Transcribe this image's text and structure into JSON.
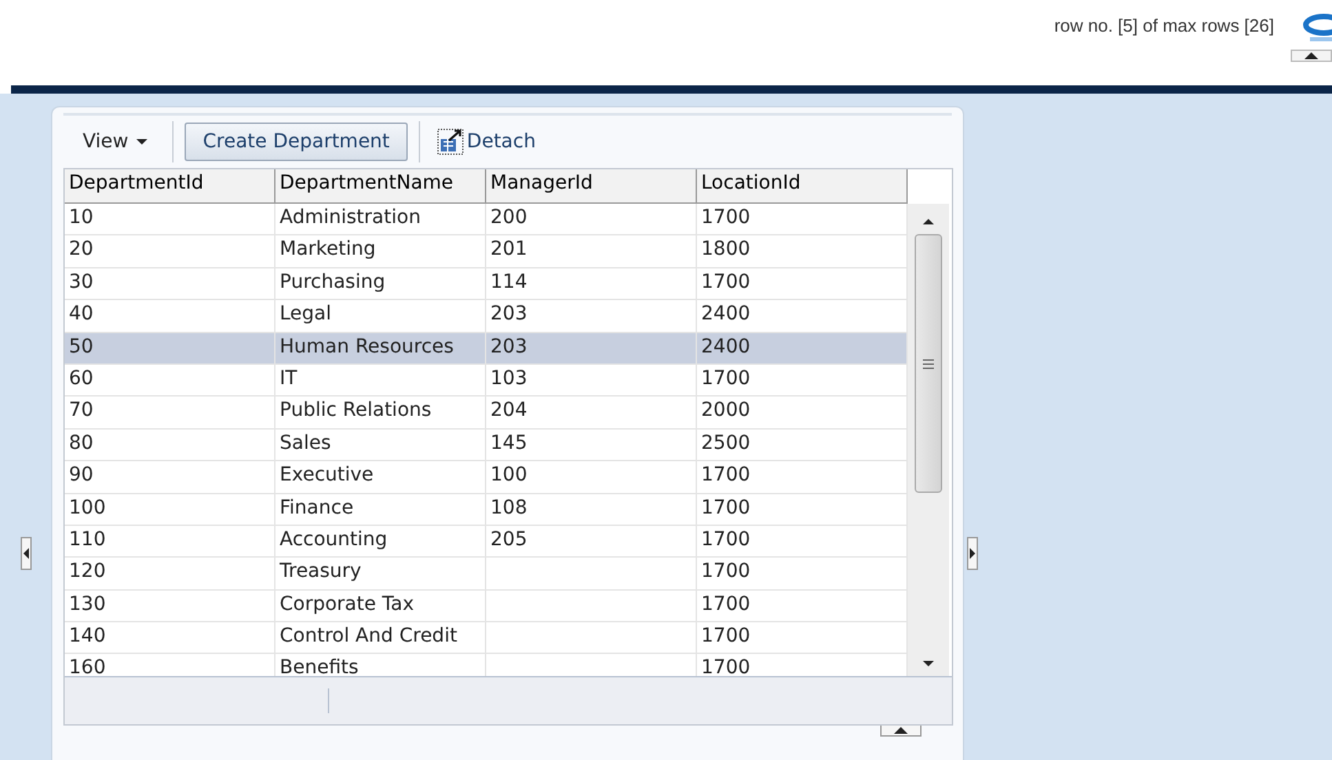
{
  "header": {
    "status": "row no. [5] of max rows [26]"
  },
  "toolbar": {
    "view_menu": "View",
    "create_button": "Create Department",
    "detach_button": "Detach"
  },
  "table": {
    "columns": [
      "DepartmentId",
      "DepartmentName",
      "ManagerId",
      "LocationId"
    ],
    "rows": [
      {
        "cells": [
          "10",
          "Administration",
          "200",
          "1700"
        ],
        "selected": false
      },
      {
        "cells": [
          "20",
          "Marketing",
          "201",
          "1800"
        ],
        "selected": false
      },
      {
        "cells": [
          "30",
          "Purchasing",
          "114",
          "1700"
        ],
        "selected": false
      },
      {
        "cells": [
          "40",
          "Legal",
          "203",
          "2400"
        ],
        "selected": false
      },
      {
        "cells": [
          "50",
          "Human Resources",
          "203",
          "2400"
        ],
        "selected": true
      },
      {
        "cells": [
          "60",
          "IT",
          "103",
          "1700"
        ],
        "selected": false
      },
      {
        "cells": [
          "70",
          "Public Relations",
          "204",
          "2000"
        ],
        "selected": false
      },
      {
        "cells": [
          "80",
          "Sales",
          "145",
          "2500"
        ],
        "selected": false
      },
      {
        "cells": [
          "90",
          "Executive",
          "100",
          "1700"
        ],
        "selected": false
      },
      {
        "cells": [
          "100",
          "Finance",
          "108",
          "1700"
        ],
        "selected": false
      },
      {
        "cells": [
          "110",
          "Accounting",
          "205",
          "1700"
        ],
        "selected": false
      },
      {
        "cells": [
          "120",
          "Treasury",
          null,
          "1700"
        ],
        "selected": false
      },
      {
        "cells": [
          "130",
          "Corporate Tax",
          null,
          "1700"
        ],
        "selected": false
      },
      {
        "cells": [
          "140",
          "Control And Credit",
          null,
          "1700"
        ],
        "selected": false
      },
      {
        "cells": [
          "160",
          "Benefits",
          null,
          "1700"
        ],
        "selected": false
      }
    ]
  }
}
